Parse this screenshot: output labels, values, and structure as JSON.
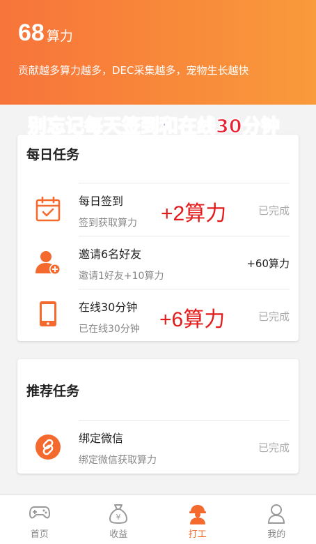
{
  "header": {
    "power_value": "68",
    "power_unit": "算力",
    "slogan": "贡献越多算力越多，DEC采集越多，宠物生长越快"
  },
  "banner": {
    "part1": "别忘记",
    "part2": "每天签到",
    "part3": "和",
    "part4": "在线30分钟"
  },
  "daily": {
    "title": "每日任务",
    "tasks": [
      {
        "title": "每日签到",
        "subtitle": "签到获取算力",
        "status": "已完成",
        "annotation": "+2算力",
        "icon": "calendar-check-icon"
      },
      {
        "title": "邀请6名好友",
        "subtitle": "邀请1好友+10算力",
        "reward": "+60算力",
        "icon": "add-user-icon"
      },
      {
        "title": "在线30分钟",
        "subtitle": "已在线30分钟",
        "status": "已完成",
        "annotation": "+6算力",
        "icon": "phone-icon"
      }
    ]
  },
  "recommended": {
    "title": "推荐任务",
    "tasks": [
      {
        "title": "绑定微信",
        "subtitle": "绑定微信获取算力",
        "status": "已完成",
        "icon": "link-icon"
      }
    ]
  },
  "tabbar": {
    "items": [
      {
        "label": "首页",
        "icon": "gamepad-icon"
      },
      {
        "label": "收益",
        "icon": "money-bag-icon"
      },
      {
        "label": "打工",
        "icon": "worker-icon",
        "active": true
      },
      {
        "label": "我的",
        "icon": "user-icon"
      }
    ]
  },
  "colors": {
    "accent": "#f46a2e",
    "header_start": "#f7743a",
    "header_end": "#f99a3b",
    "annotation_red": "#e31b1b",
    "banner_blue": "#283bbf",
    "banner_red": "#ea2332"
  }
}
